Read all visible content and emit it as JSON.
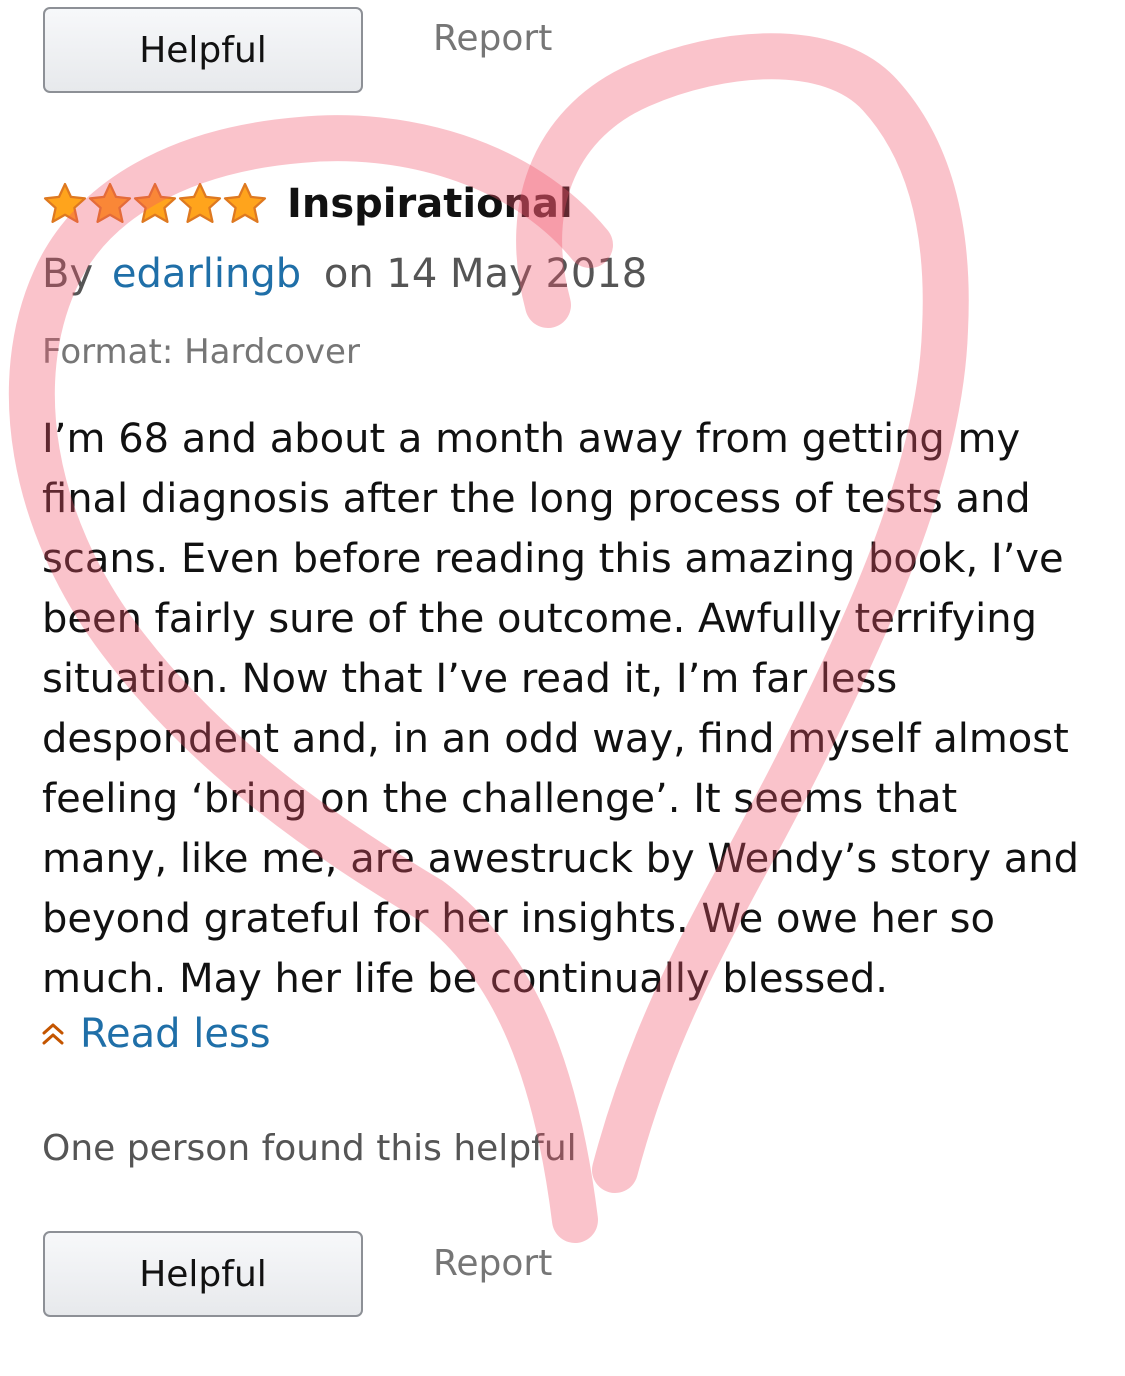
{
  "top_actions": {
    "helpful_label": "Helpful",
    "report_label": "Report"
  },
  "review": {
    "rating": 5,
    "rating_max": 5,
    "title": "Inspirational",
    "by_prefix": "By",
    "author": "edarlingb",
    "date": "on 14 May 2018",
    "format": "Format: Hardcover",
    "body_lines": [
      "I’m 68 and about a month away from getting my",
      "final diagnosis after the long process of tests and",
      "scans. Even before reading this amazing book, I’ve",
      "been fairly sure of the outcome. Awfully terrifying",
      "situation. Now that I’ve read it, I’m far less",
      "despondent and, in an odd way, find myself almost",
      "feeling ‘bring on the challenge’. It seems that",
      "many, like me, are awestruck by Wendy’s story and",
      "beyond grateful for her insights. We owe her so",
      "much. May her life be continually blessed."
    ],
    "read_less_label": "Read less",
    "helpful_count_text": "One person found this helpful"
  },
  "bottom_actions": {
    "helpful_label": "Helpful",
    "report_label": "Report"
  },
  "colors": {
    "link": "#1f6fa8",
    "star_fill": "#ffa41c",
    "star_outline": "#de7921",
    "heart_overlay": "#f0526a"
  },
  "icons": {
    "star": "star-icon",
    "read_less": "double-chevron-up-icon",
    "overlay": "heart-drawing"
  }
}
